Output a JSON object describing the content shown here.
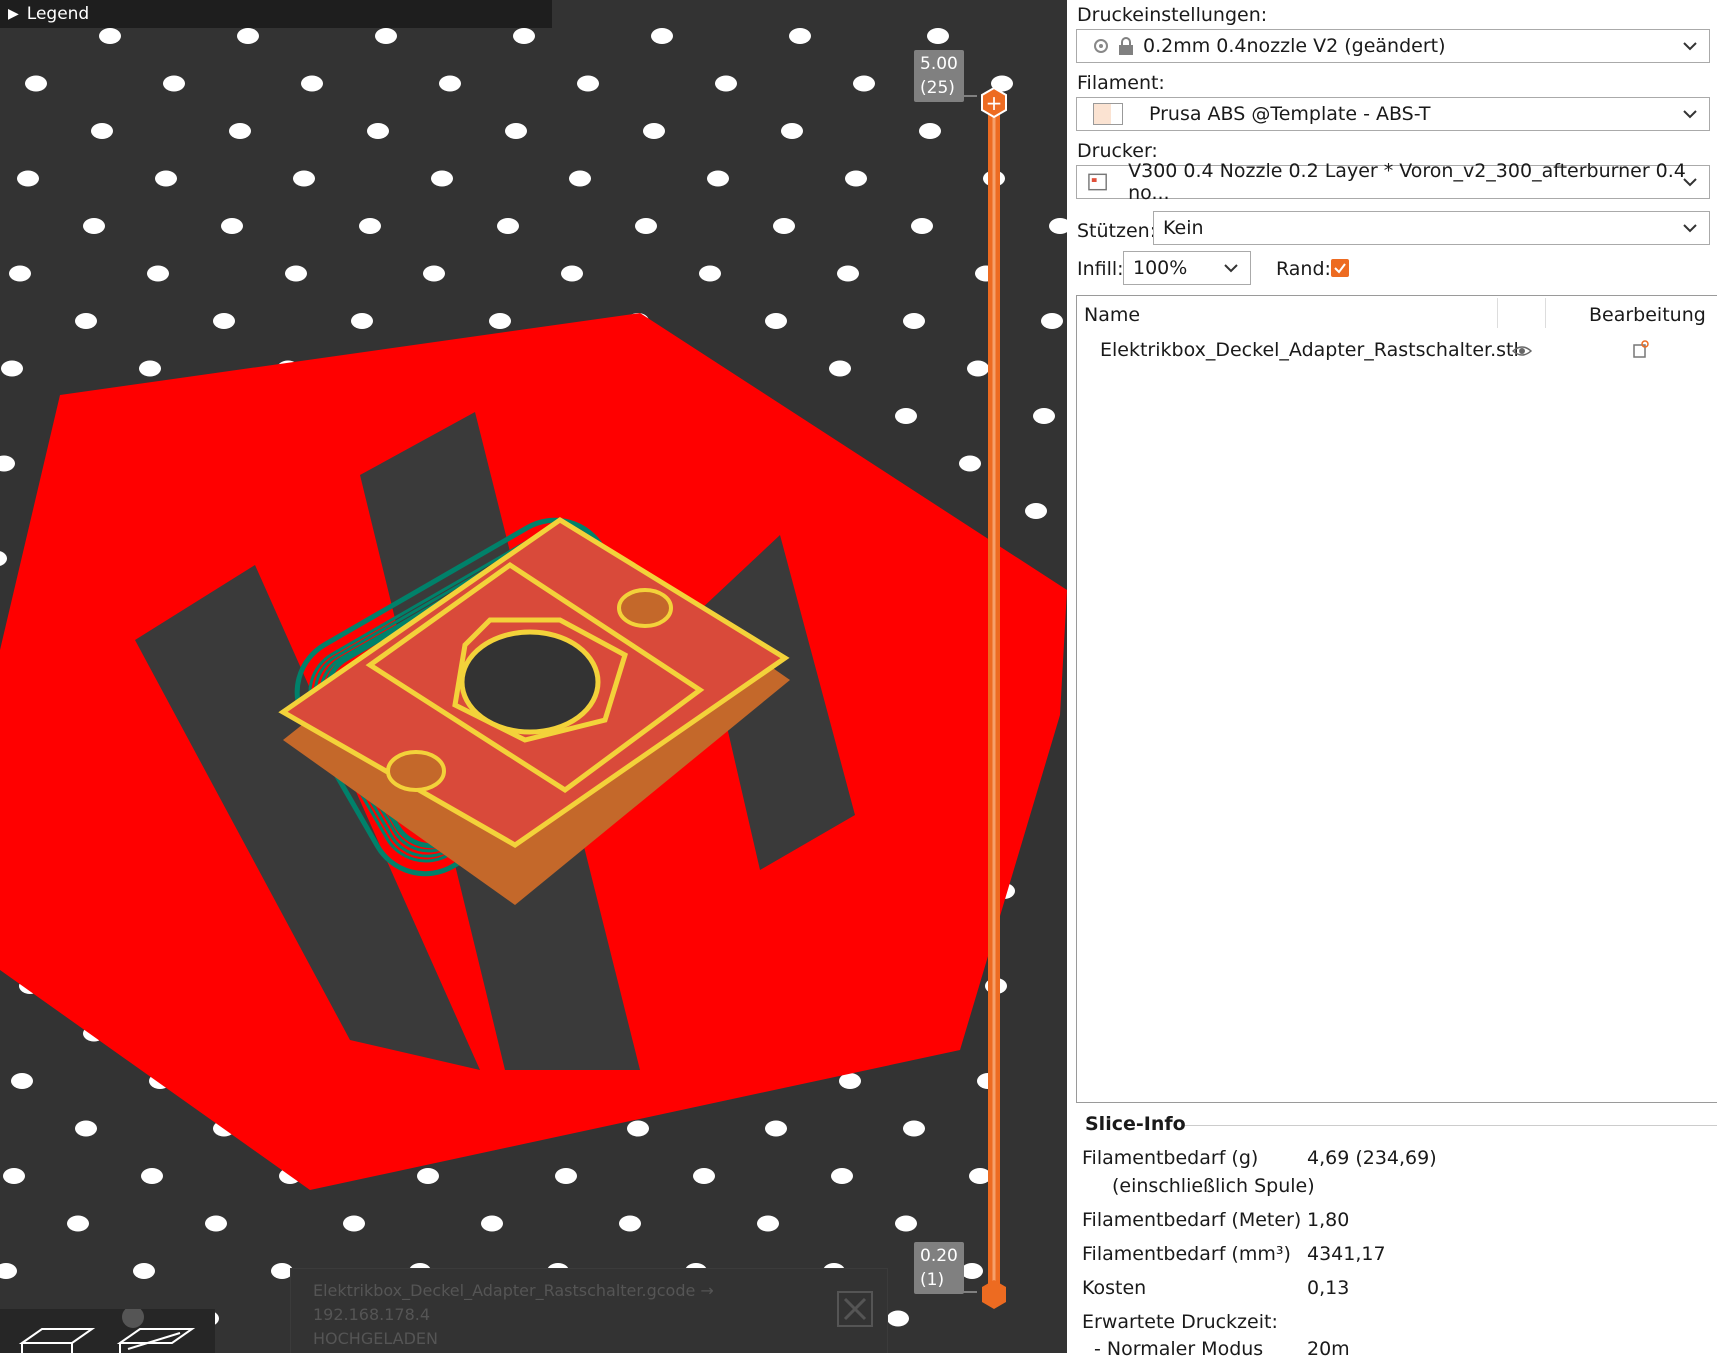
{
  "viewport": {
    "legend_label": "Legend",
    "slider_top": {
      "height": "5.00",
      "layer": "(25)"
    },
    "slider_bottom": {
      "height": "0.20",
      "layer": "(1)"
    },
    "toast": {
      "file": "Elektrikbox_Deckel_Adapter_Rastschalter.gcode →",
      "host": "192.168.178.4",
      "status": "HOCHGELADEN"
    },
    "colors": {
      "background": "#333333",
      "bed_logo": "#ff0000",
      "skirt": "#00816a",
      "perimeter": "#f3d23a",
      "infill": "#d94a3a",
      "slider": "#ed6b21"
    }
  },
  "panel": {
    "print_settings": {
      "label": "Druckeinstellungen:",
      "value": "0.2mm 0.4nozzle V2 (geändert)"
    },
    "filament": {
      "label": "Filament:",
      "value": "Prusa ABS @Template - ABS-T"
    },
    "printer": {
      "label": "Drucker:",
      "value": "V300 0.4 Nozzle 0.2 Layer * Voron_v2_300_afterburner 0.4 no..."
    },
    "supports": {
      "label": "Stützen:",
      "value": "Kein"
    },
    "infill": {
      "label": "Infill:",
      "value": "100%"
    },
    "brim": {
      "label": "Rand:",
      "checked": true
    },
    "object_list": {
      "col_name": "Name",
      "col_edit": "Bearbeitung",
      "objects": [
        {
          "name": "Elektrikbox_Deckel_Adapter_Rastschalter.stl"
        }
      ]
    },
    "slice_info": {
      "title": "Slice-Info",
      "filament_g_label": "Filamentbedarf (g)",
      "filament_g_sub": "(einschließlich Spule)",
      "filament_g_value": "4,69 (234,69)",
      "filament_m_label": "Filamentbedarf (Meter)",
      "filament_m_value": "1,80",
      "filament_mm3_label": "Filamentbedarf (mm³)",
      "filament_mm3_value": "4341,17",
      "cost_label": "Kosten",
      "cost_value": "0,13",
      "time_label": "Erwartete Druckzeit:",
      "normal_mode_label": "- Normaler Modus",
      "normal_mode_value": "20m"
    }
  }
}
